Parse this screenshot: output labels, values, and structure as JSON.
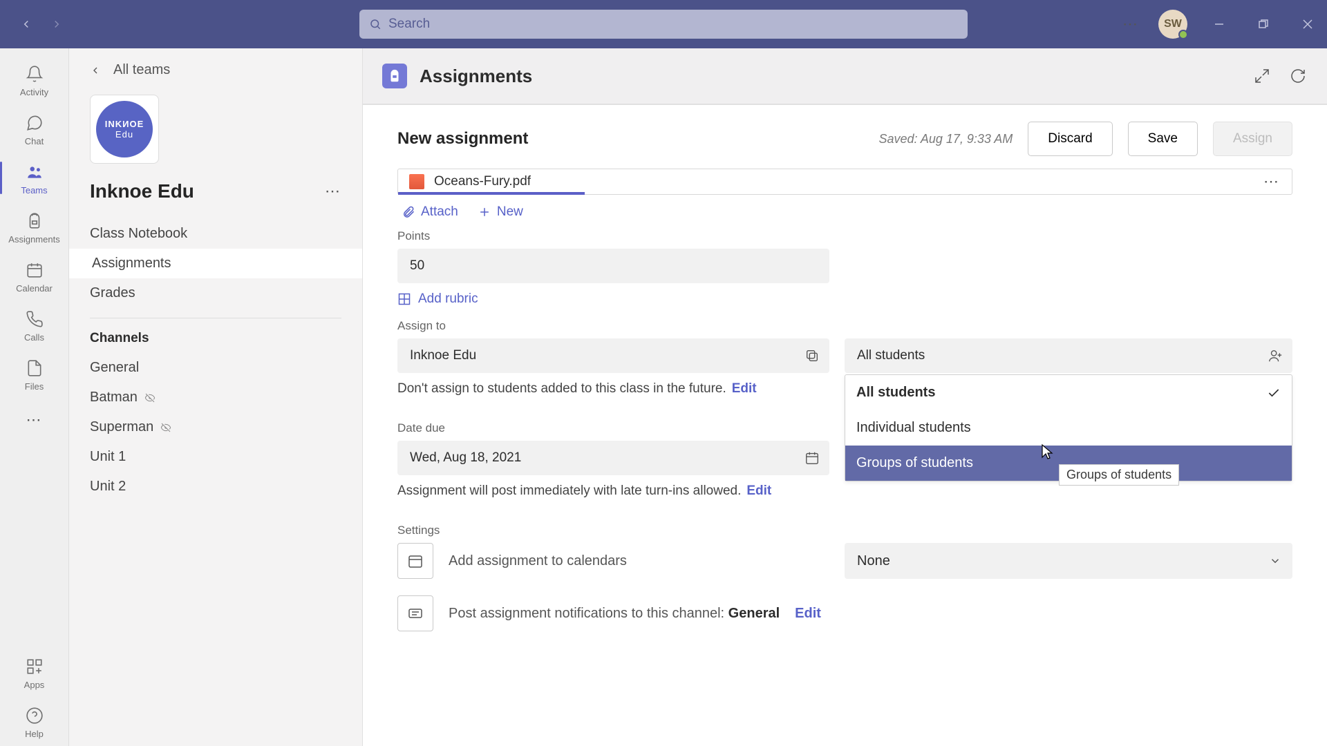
{
  "titlebar": {
    "search_placeholder": "Search",
    "avatar_initials": "SW"
  },
  "rail": {
    "items": [
      {
        "label": "Activity"
      },
      {
        "label": "Chat"
      },
      {
        "label": "Teams"
      },
      {
        "label": "Assignments"
      },
      {
        "label": "Calendar"
      },
      {
        "label": "Calls"
      },
      {
        "label": "Files"
      }
    ],
    "apps_label": "Apps",
    "help_label": "Help"
  },
  "sidebar": {
    "back_label": "All teams",
    "team_logo_line1": "INKИOE",
    "team_logo_line2": "Edu",
    "team_name": "Inknoe Edu",
    "items": [
      {
        "label": "Class Notebook"
      },
      {
        "label": "Assignments"
      },
      {
        "label": "Grades"
      }
    ],
    "channels_header": "Channels",
    "channels": [
      {
        "label": "General",
        "hidden": false
      },
      {
        "label": "Batman",
        "hidden": true
      },
      {
        "label": "Superman",
        "hidden": true
      },
      {
        "label": "Unit 1",
        "hidden": false
      },
      {
        "label": "Unit 2",
        "hidden": false
      }
    ]
  },
  "header": {
    "title": "Assignments"
  },
  "form": {
    "title": "New assignment",
    "saved_text": "Saved: Aug 17, 9:33 AM",
    "discard": "Discard",
    "save": "Save",
    "assign": "Assign",
    "attachment": "Oceans-Fury.pdf",
    "attach_label": "Attach",
    "new_label": "New",
    "points_label": "Points",
    "points_value": "50",
    "add_rubric": "Add rubric",
    "assign_to_label": "Assign to",
    "class_value": "Inknoe Edu",
    "students_value": "All students",
    "future_note": "Don't assign to students added to this class in the future.",
    "edit": "Edit",
    "dropdown_options": [
      "All students",
      "Individual students",
      "Groups of students"
    ],
    "tooltip_text": "Groups of students",
    "date_due_label": "Date due",
    "date_due_value": "Wed, Aug 18, 2021",
    "post_note": "Assignment will post immediately with late turn-ins allowed.",
    "settings_label": "Settings",
    "calendar_setting": "Add assignment to calendars",
    "calendar_value": "None",
    "channel_setting_prefix": "Post assignment notifications to this channel: ",
    "channel_setting_value": "General"
  }
}
